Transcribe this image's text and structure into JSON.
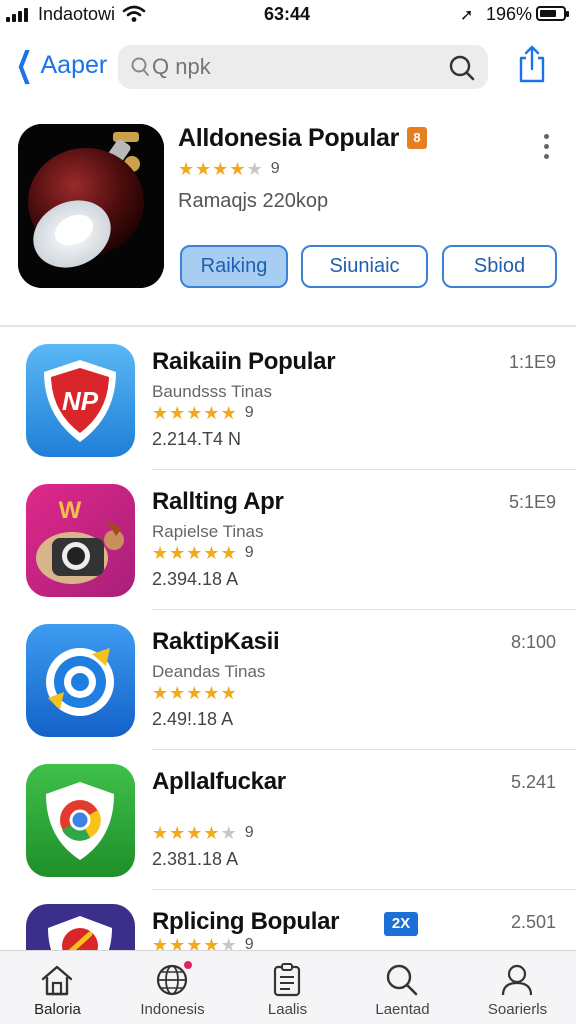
{
  "status": {
    "carrier": "Indaotowi",
    "time": "63:44",
    "battery": "196%"
  },
  "nav": {
    "back_label": "Aaper",
    "search_placeholder": "Q npk"
  },
  "featured": {
    "title": "Alldonesia Popular",
    "badge": "8",
    "rating_count": "9",
    "rating": 4,
    "subtitle": "Ramaqjs 220kop",
    "buttons": [
      "Raiking",
      "Siuniaic",
      "Sbiod"
    ]
  },
  "apps": [
    {
      "name": "Raikaiin Popular",
      "category": "Baundsss Tinas",
      "rating": 4.5,
      "rating_count": "9",
      "size": "2.214.T4 N",
      "right": "1:1E9",
      "tag": ""
    },
    {
      "name": "Rallting Apr",
      "category": "Rapielse Tinas",
      "rating": 4.5,
      "rating_count": "9",
      "size": "2.394.18 A",
      "right": "5:1E9",
      "tag": ""
    },
    {
      "name": "RaktipKasii",
      "category": "Deandas Tinas",
      "rating": 4.5,
      "rating_count": "",
      "size": "2.49!.18 A",
      "right": "8:100",
      "tag": ""
    },
    {
      "name": "ApllaIfuckar",
      "category": "",
      "rating": 4,
      "rating_count": "9",
      "size": "2.381.18 A",
      "right": "5.241",
      "tag": ""
    },
    {
      "name": "Rplicing Bopular",
      "category": "",
      "rating": 4,
      "rating_count": "9",
      "size": "",
      "right": "2.501",
      "tag": "2X"
    }
  ],
  "tabs": [
    {
      "label": "Baloria",
      "icon": "home-icon"
    },
    {
      "label": "Indonesis",
      "icon": "globe-icon"
    },
    {
      "label": "Laalis",
      "icon": "list-icon"
    },
    {
      "label": "Laentad",
      "icon": "search-icon"
    },
    {
      "label": "Soarierls",
      "icon": "person-icon"
    }
  ],
  "colors": {
    "accent": "#1a73e8",
    "star": "#f2a91c",
    "pill_active": "#a7cdf3"
  }
}
